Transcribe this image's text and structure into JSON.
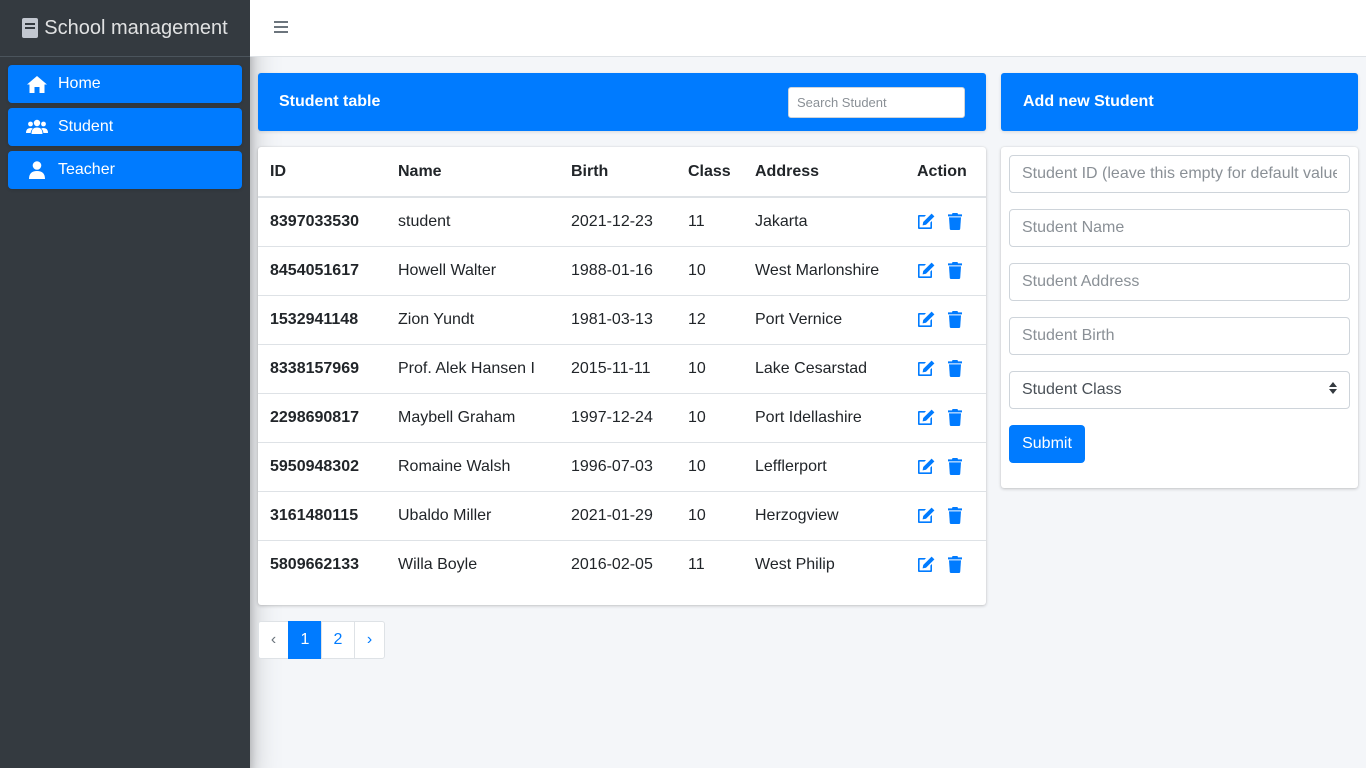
{
  "app": {
    "title": "School management"
  },
  "sidebar": {
    "items": [
      {
        "label": "Home",
        "icon": "home-icon"
      },
      {
        "label": "Student",
        "icon": "users-icon"
      },
      {
        "label": "Teacher",
        "icon": "user-icon"
      }
    ]
  },
  "student_table": {
    "title": "Student table",
    "search_placeholder": "Search Student",
    "columns": [
      "ID",
      "Name",
      "Birth",
      "Class",
      "Address",
      "Action"
    ],
    "rows": [
      {
        "id": "8397033530",
        "name": "student",
        "birth": "2021-12-23",
        "class": "11",
        "address": "Jakarta"
      },
      {
        "id": "8454051617",
        "name": "Howell Walter",
        "birth": "1988-01-16",
        "class": "10",
        "address": "West Marlonshire"
      },
      {
        "id": "1532941148",
        "name": "Zion Yundt",
        "birth": "1981-03-13",
        "class": "12",
        "address": "Port Vernice"
      },
      {
        "id": "8338157969",
        "name": "Prof. Alek Hansen I",
        "birth": "2015-11-11",
        "class": "10",
        "address": "Lake Cesarstad"
      },
      {
        "id": "2298690817",
        "name": "Maybell Graham",
        "birth": "1997-12-24",
        "class": "10",
        "address": "Port Idellashire"
      },
      {
        "id": "5950948302",
        "name": "Romaine Walsh",
        "birth": "1996-07-03",
        "class": "10",
        "address": "Lefflerport"
      },
      {
        "id": "3161480115",
        "name": "Ubaldo Miller",
        "birth": "2021-01-29",
        "class": "10",
        "address": "Herzogview"
      },
      {
        "id": "5809662133",
        "name": "Willa Boyle",
        "birth": "2016-02-05",
        "class": "11",
        "address": "West Philip"
      }
    ]
  },
  "pagination": {
    "prev": "‹",
    "pages": [
      "1",
      "2"
    ],
    "active": "1",
    "next": "›"
  },
  "add_student": {
    "title": "Add new Student",
    "id_placeholder": "Student ID (leave this empty for default value)",
    "name_placeholder": "Student Name",
    "address_placeholder": "Student Address",
    "birth_placeholder": "Student Birth",
    "class_select": "Student Class",
    "submit_label": "Submit"
  },
  "colors": {
    "accent": "#007bff",
    "sidebar": "#343a40",
    "background": "#f4f6f9"
  }
}
